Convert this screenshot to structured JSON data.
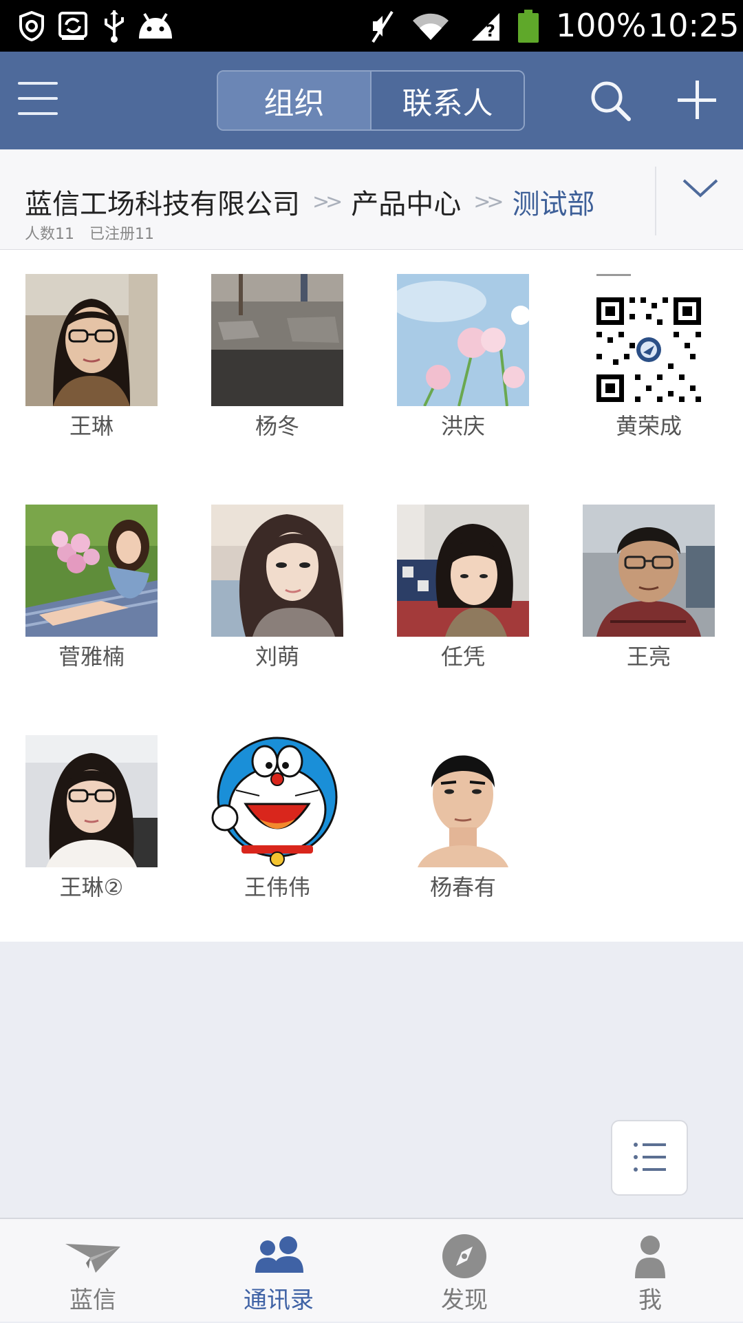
{
  "status_bar": {
    "battery": "100%",
    "time": "10:25",
    "icons": [
      "shield-icon",
      "sync-icon",
      "usb-icon",
      "android-icon",
      "mute-icon",
      "wifi-icon",
      "signal-icon",
      "battery-icon"
    ]
  },
  "header": {
    "tabs": [
      {
        "label": "组织",
        "active": true
      },
      {
        "label": "联系人",
        "active": false
      }
    ],
    "icons": [
      "menu-icon",
      "search-icon",
      "plus-icon"
    ]
  },
  "breadcrumb": {
    "items": [
      "蓝信工场科技有限公司",
      "产品中心",
      "测试部"
    ],
    "separator": ">>",
    "stats": {
      "count_label": "人数11",
      "registered_label": "已注册11"
    }
  },
  "members": [
    {
      "name": "王琳"
    },
    {
      "name": "杨冬"
    },
    {
      "name": "洪庆"
    },
    {
      "name": "黄荣成"
    },
    {
      "name": "菅雅楠"
    },
    {
      "name": "刘萌"
    },
    {
      "name": "任凭"
    },
    {
      "name": "王亮"
    },
    {
      "name": "王琳②"
    },
    {
      "name": "王伟伟"
    },
    {
      "name": "杨春有"
    }
  ],
  "bottom_nav": {
    "items": [
      {
        "label": "蓝信",
        "icon": "paper-plane-icon",
        "active": false
      },
      {
        "label": "通讯录",
        "icon": "contacts-icon",
        "active": true
      },
      {
        "label": "发现",
        "icon": "compass-icon",
        "active": false
      },
      {
        "label": "我",
        "icon": "person-icon",
        "active": false
      }
    ]
  },
  "colors": {
    "header": "#4e6a9b",
    "active_tab": "#6b86b5",
    "accent": "#3f62a5",
    "breadcrumb_current": "#3d5f98"
  }
}
